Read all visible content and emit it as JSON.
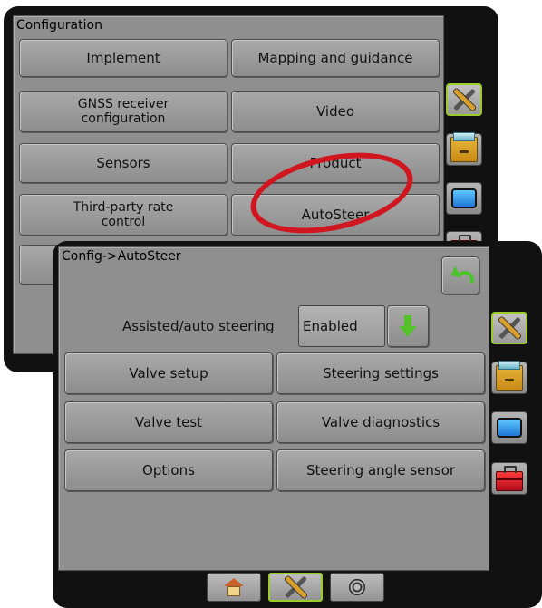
{
  "background_screen": {
    "title": "Configuration",
    "buttons": [
      "Implement",
      "Mapping and guidance",
      "GNSS receiver configuration",
      "Video",
      "Sensors",
      "Product",
      "Third-party rate control",
      "AutoSteer"
    ]
  },
  "foreground_screen": {
    "title": "Config->AutoSteer",
    "steering_mode": {
      "label": "Assisted/auto steering",
      "value": "Enabled"
    },
    "buttons": [
      "Valve setup",
      "Steering settings",
      "Valve test",
      "Valve diagnostics",
      "Options",
      "Steering angle sensor"
    ]
  },
  "side_tabs": [
    "tools-icon",
    "drawer-icon",
    "screen-icon",
    "toolbox-icon"
  ],
  "bottom_tabs": [
    "home-icon",
    "tools-icon",
    "dial-icon"
  ],
  "colors": {
    "accent_active": "#9ccc2a",
    "highlight_circle": "#d0161e",
    "arrow_green": "#4ac32c"
  }
}
